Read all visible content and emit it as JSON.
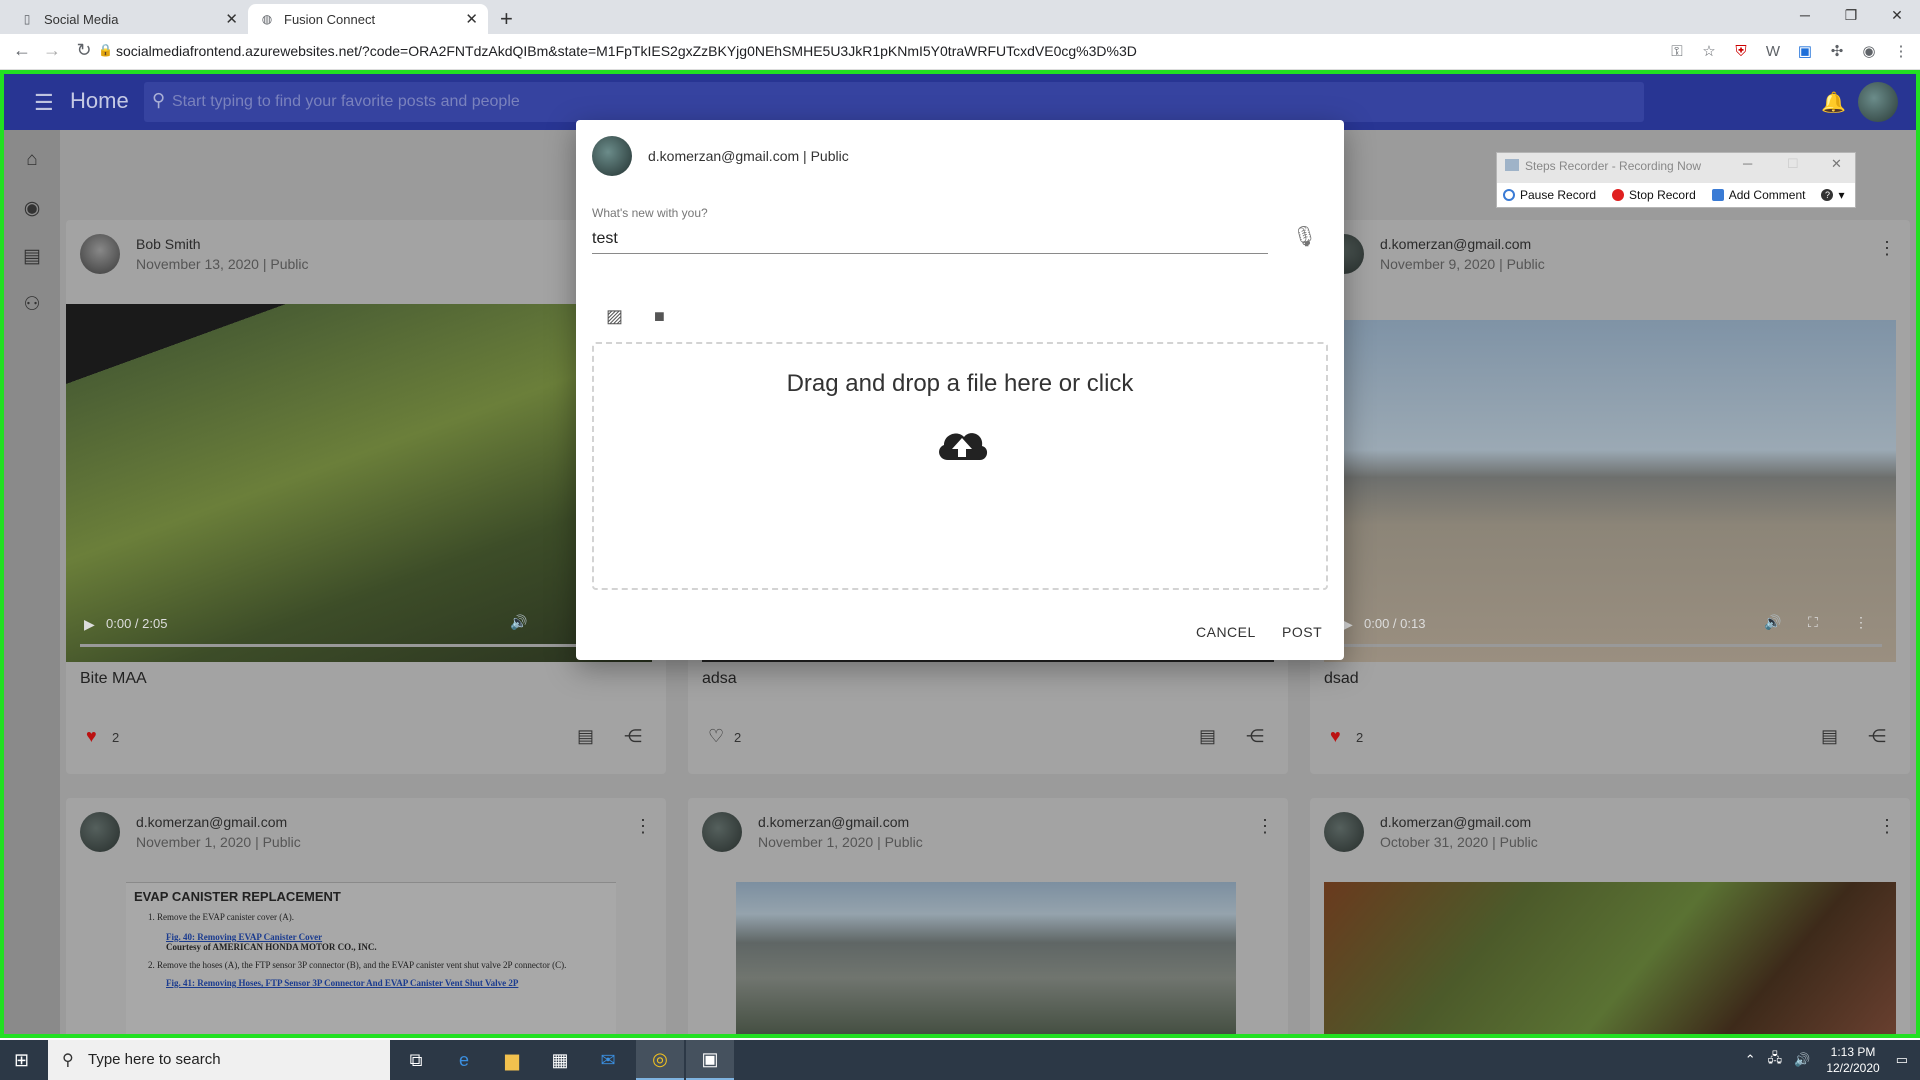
{
  "browser": {
    "tabs": [
      {
        "label": "Social Media"
      },
      {
        "label": "Fusion Connect"
      }
    ],
    "url": "socialmediafrontend.azurewebsites.net/?code=ORA2FNTdzAkdQIBm&state=M1FpTkIES2gxZzBKYjg0NEhSMHE5U3JkR1pKNmI5Y0traWRFUTcxdVE0cg%3D%3D"
  },
  "app": {
    "home_title": "Home",
    "search_placeholder": "Start typing to find your favorite posts and people"
  },
  "steps_recorder": {
    "title": "Steps Recorder - Recording Now",
    "pause_label": "Pause Record",
    "stop_label": "Stop Record",
    "comment_label": "Add Comment"
  },
  "posts": [
    {
      "name": "Bob Smith",
      "date": "November 13, 2020 | Public",
      "title": "Bite MAA",
      "likes": "2",
      "time": "0:00 / 2:05"
    },
    {
      "name": "",
      "date": "",
      "title": "adsa",
      "likes": "2",
      "time": ""
    },
    {
      "name": "d.komerzan@gmail.com",
      "date": "November 9, 2020 | Public",
      "title": "dsad",
      "likes": "2",
      "time": "0:00 / 0:13"
    },
    {
      "name": "d.komerzan@gmail.com",
      "date": "November 1, 2020 | Public"
    },
    {
      "name": "d.komerzan@gmail.com",
      "date": "November 1, 2020 | Public"
    },
    {
      "name": "d.komerzan@gmail.com",
      "date": "October 31, 2020 | Public"
    }
  ],
  "doc_preview": {
    "heading": "EVAP CANISTER REPLACEMENT",
    "line1": "1.   Remove the EVAP canister cover (A).",
    "fig1": "Fig. 40: Removing EVAP Canister Cover",
    "courtesy": "Courtesy of AMERICAN HONDA MOTOR CO., INC.",
    "line2": "2.   Remove the hoses (A), the FTP sensor 3P connector (B), and the EVAP canister vent shut valve 2P connector (C).",
    "fig2": "Fig. 41: Removing Hoses, FTP Sensor 3P Connector And EVAP Canister Vent Shut Valve 2P"
  },
  "modal": {
    "user": "d.komerzan@gmail.com | Public",
    "label": "What's new with you?",
    "input_value": "test",
    "dropzone_text": "Drag and drop a file here or click",
    "cancel_label": "CANCEL",
    "post_label": "POST"
  },
  "taskbar": {
    "search_placeholder": "Type here to search",
    "time": "1:13 PM",
    "date": "12/2/2020"
  }
}
